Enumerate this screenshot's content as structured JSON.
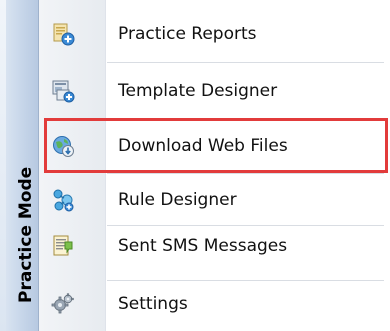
{
  "sidebar": {
    "title": "Practice Mode"
  },
  "menu": {
    "items": [
      {
        "label": "Practice Reports",
        "icon": "report-document-add-icon"
      },
      {
        "label": "Template Designer",
        "icon": "template-designer-icon"
      },
      {
        "label": "Download Web Files",
        "icon": "globe-download-icon"
      },
      {
        "label": "Rule Designer",
        "icon": "rule-designer-icon"
      },
      {
        "label": "Sent SMS Messages",
        "icon": "sms-messages-icon"
      },
      {
        "label": "Settings",
        "icon": "settings-gear-icon"
      }
    ]
  },
  "colors": {
    "highlight_border": "#e23b3b"
  }
}
